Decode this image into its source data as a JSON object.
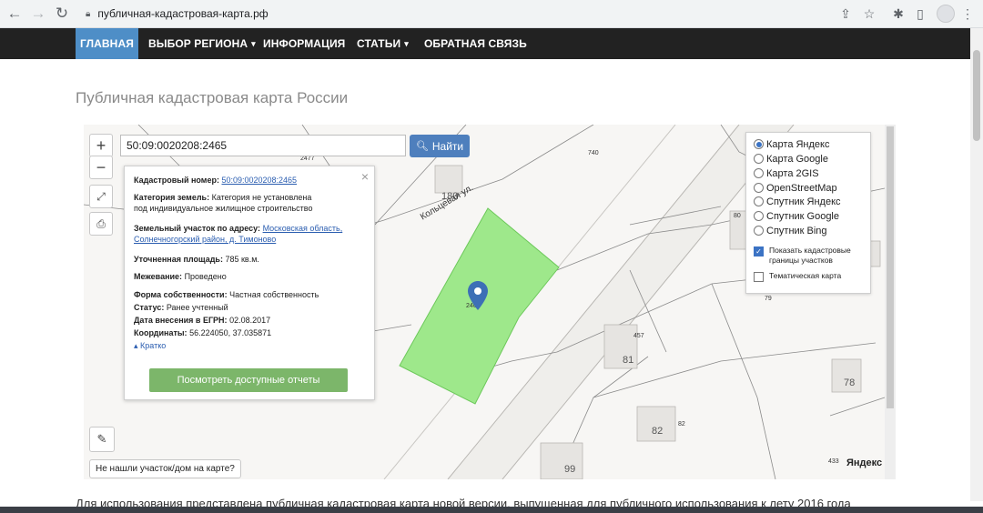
{
  "browser": {
    "url": "публичная-кадастровая-карта.рф"
  },
  "nav": {
    "items": [
      {
        "label": "ГЛАВНАЯ",
        "active": true
      },
      {
        "label": "ВЫБОР РЕГИОНА",
        "caret": true
      },
      {
        "label": "ИНФОРМАЦИЯ"
      },
      {
        "label": "СТАТЬИ",
        "caret": true
      },
      {
        "label": "ОБРАТНАЯ СВЯЗЬ"
      }
    ],
    "active_color": "#4e8ec7",
    "bar_color": "#222222"
  },
  "page": {
    "title": "Публичная кадастровая карта России",
    "bottom_text": "Для использования представлена публичная кадастровая карта новой версии, выпущенная для публичного использования к лету 2016 года"
  },
  "map": {
    "zoom_in": "+",
    "zoom_out": "−",
    "search_value": "50:09:0020208:2465",
    "search_button": "Найти",
    "not_found_button": "Не нашли участок/дом на карте?",
    "street_label": "Кольцевая ул.",
    "yandex_logo": "Яндекс",
    "parcel_color": "#9ee88b",
    "plot_numbers": [
      "2477",
      "740",
      "180",
      "80",
      "79",
      "457",
      "81",
      "78",
      "82",
      "82",
      "99",
      "433",
      "246"
    ],
    "building_numbers": [
      "180",
      "81",
      "78",
      "82",
      "99"
    ]
  },
  "popup": {
    "cadastral_label": "Кадастровый номер:",
    "cadastral_value": "50:09:0020208:2465",
    "category_label": "Категория земель:",
    "category_value_1": "Категория не установлена",
    "category_value_2": "под индивидуальное жилищное строительство",
    "address_label": "Земельный участок по адресу:",
    "address_value_1": "Московская область,",
    "address_value_2": "Солнечногорский район, д. Тимоново",
    "area_label": "Уточненная площадь:",
    "area_value": "785 кв.м.",
    "survey_label": "Межевание:",
    "survey_value": "Проведено",
    "ownership_label": "Форма собственности:",
    "ownership_value": "Частная собственность",
    "status_label": "Статус:",
    "status_value": "Ранее учтенный",
    "date_label": "Дата внесения в ЕГРН:",
    "date_value": "02.08.2017",
    "coords_label": "Координаты:",
    "coords_value": "56.224050, 37.035871",
    "short_link": "Кратко",
    "reports_button": "Посмотреть доступные отчеты",
    "close": "×"
  },
  "layers": {
    "options": [
      {
        "label": "Карта Яндекс",
        "selected": true
      },
      {
        "label": "Карта Google",
        "selected": false
      },
      {
        "label": "Карта 2GIS",
        "selected": false
      },
      {
        "label": "OpenStreetMap",
        "selected": false
      },
      {
        "label": "Спутник Яндекс",
        "selected": false
      },
      {
        "label": "Спутник Google",
        "selected": false
      },
      {
        "label": "Спутник Bing",
        "selected": false
      }
    ],
    "show_borders_1": "Показать кадастровые",
    "show_borders_2": "границы участков",
    "show_borders_checked": true,
    "thematic": "Тематическая карта",
    "thematic_checked": false
  }
}
